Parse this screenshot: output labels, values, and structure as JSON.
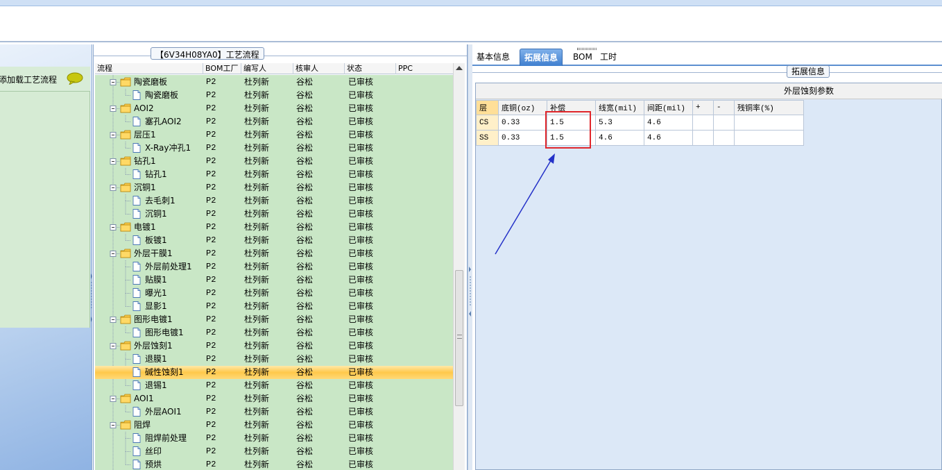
{
  "left": {
    "action_label": "添加载工艺流程"
  },
  "tree": {
    "caption": "【6V34H08YA0】工艺流程",
    "columns": [
      "流程",
      "BOM工厂",
      "编写人",
      "核审人",
      "状态",
      "PPC"
    ],
    "rows": [
      {
        "name": "陶瓷磨板",
        "level": 1,
        "factory": "P2",
        "author": "杜列新",
        "reviewer": "谷松",
        "status": "已审核"
      },
      {
        "name": "陶瓷磨板",
        "level": 2,
        "factory": "P2",
        "author": "杜列新",
        "reviewer": "谷松",
        "status": "已审核"
      },
      {
        "name": "AOI2",
        "level": 1,
        "factory": "P2",
        "author": "杜列新",
        "reviewer": "谷松",
        "status": "已审核"
      },
      {
        "name": "塞孔AOI2",
        "level": 2,
        "factory": "P2",
        "author": "杜列新",
        "reviewer": "谷松",
        "status": "已审核"
      },
      {
        "name": "层压1",
        "level": 1,
        "factory": "P2",
        "author": "杜列新",
        "reviewer": "谷松",
        "status": "已审核"
      },
      {
        "name": "X-Ray冲孔1",
        "level": 2,
        "factory": "P2",
        "author": "杜列新",
        "reviewer": "谷松",
        "status": "已审核"
      },
      {
        "name": "钻孔1",
        "level": 1,
        "factory": "P2",
        "author": "杜列新",
        "reviewer": "谷松",
        "status": "已审核"
      },
      {
        "name": "钻孔1",
        "level": 2,
        "factory": "P2",
        "author": "杜列新",
        "reviewer": "谷松",
        "status": "已审核"
      },
      {
        "name": "沉铜1",
        "level": 1,
        "factory": "P2",
        "author": "杜列新",
        "reviewer": "谷松",
        "status": "已审核"
      },
      {
        "name": "去毛刺1",
        "level": 2,
        "factory": "P2",
        "author": "杜列新",
        "reviewer": "谷松",
        "status": "已审核"
      },
      {
        "name": "沉铜1",
        "level": 2,
        "factory": "P2",
        "author": "杜列新",
        "reviewer": "谷松",
        "status": "已审核"
      },
      {
        "name": "电镀1",
        "level": 1,
        "factory": "P2",
        "author": "杜列新",
        "reviewer": "谷松",
        "status": "已审核"
      },
      {
        "name": "板镀1",
        "level": 2,
        "factory": "P2",
        "author": "杜列新",
        "reviewer": "谷松",
        "status": "已审核"
      },
      {
        "name": "外层干膜1",
        "level": 1,
        "factory": "P2",
        "author": "杜列新",
        "reviewer": "谷松",
        "status": "已审核"
      },
      {
        "name": "外层前处理1",
        "level": 2,
        "factory": "P2",
        "author": "杜列新",
        "reviewer": "谷松",
        "status": "已审核"
      },
      {
        "name": "贴膜1",
        "level": 2,
        "factory": "P2",
        "author": "杜列新",
        "reviewer": "谷松",
        "status": "已审核"
      },
      {
        "name": "曝光1",
        "level": 2,
        "factory": "P2",
        "author": "杜列新",
        "reviewer": "谷松",
        "status": "已审核"
      },
      {
        "name": "显影1",
        "level": 2,
        "factory": "P2",
        "author": "杜列新",
        "reviewer": "谷松",
        "status": "已审核"
      },
      {
        "name": "图形电镀1",
        "level": 1,
        "factory": "P2",
        "author": "杜列新",
        "reviewer": "谷松",
        "status": "已审核"
      },
      {
        "name": "图形电镀1",
        "level": 2,
        "factory": "P2",
        "author": "杜列新",
        "reviewer": "谷松",
        "status": "已审核"
      },
      {
        "name": "外层蚀刻1",
        "level": 1,
        "factory": "P2",
        "author": "杜列新",
        "reviewer": "谷松",
        "status": "已审核"
      },
      {
        "name": "退膜1",
        "level": 2,
        "factory": "P2",
        "author": "杜列新",
        "reviewer": "谷松",
        "status": "已审核"
      },
      {
        "name": "碱性蚀刻1",
        "level": 2,
        "factory": "P2",
        "author": "杜列新",
        "reviewer": "谷松",
        "status": "已审核",
        "selected": true
      },
      {
        "name": "退锡1",
        "level": 2,
        "factory": "P2",
        "author": "杜列新",
        "reviewer": "谷松",
        "status": "已审核"
      },
      {
        "name": "AOI1",
        "level": 1,
        "factory": "P2",
        "author": "杜列新",
        "reviewer": "谷松",
        "status": "已审核"
      },
      {
        "name": "外层AOI1",
        "level": 2,
        "factory": "P2",
        "author": "杜列新",
        "reviewer": "谷松",
        "status": "已审核"
      },
      {
        "name": "阻焊",
        "level": 1,
        "factory": "P2",
        "author": "杜列新",
        "reviewer": "谷松",
        "status": "已审核"
      },
      {
        "name": "阻焊前处理",
        "level": 2,
        "factory": "P2",
        "author": "杜列新",
        "reviewer": "谷松",
        "status": "已审核"
      },
      {
        "name": "丝印",
        "level": 2,
        "factory": "P2",
        "author": "杜列新",
        "reviewer": "谷松",
        "status": "已审核"
      },
      {
        "name": "预烘",
        "level": 2,
        "factory": "P2",
        "author": "杜列新",
        "reviewer": "谷松",
        "status": "已审核"
      }
    ]
  },
  "right": {
    "tabs": [
      "基本信息",
      "拓展信息",
      "BOM",
      "工时"
    ],
    "active_tab": 1,
    "group_caption": "拓展信息",
    "grid_title": "外层蚀刻参数",
    "grid_columns": [
      "层",
      "底铜(oz)",
      "补偿",
      "线宽(mil)",
      "间距(mil)",
      "+",
      "-",
      "残铜率(%)"
    ],
    "grid_rows": [
      [
        "CS",
        "0.33",
        "1.5",
        "5.3",
        "4.6",
        "",
        "",
        ""
      ],
      [
        "SS",
        "0.33",
        "1.5",
        "4.6",
        "4.6",
        "",
        "",
        ""
      ]
    ]
  },
  "colors": {
    "selected_row": "#ffc84a",
    "tree_bg": "#c9e7c6",
    "highlight_box": "#e0262b",
    "annotation_arrow": "#2431c8",
    "active_tab": "#3f7fcf"
  }
}
